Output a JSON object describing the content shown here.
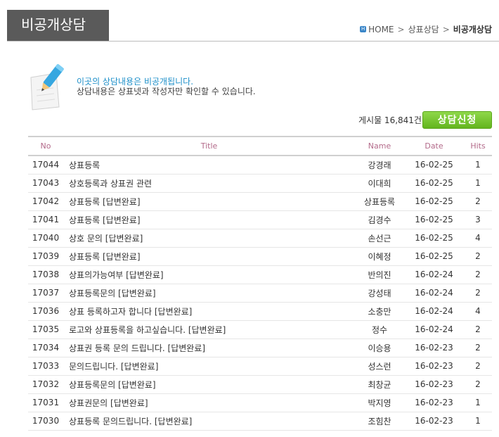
{
  "header": {
    "title": "비공개상담",
    "breadcrumb": {
      "home": "HOME",
      "parent": "상표상담",
      "current": "비공개상담",
      "separator": ">"
    }
  },
  "notice": {
    "line1": "이곳의 상담내용은 비공개됩니다.",
    "line2": "상담내용은 상표넷과 작성자만 확인할 수 있습니다."
  },
  "board": {
    "count_text": "게시물 16,841건",
    "apply_button": "상담신청",
    "columns": {
      "no": "No",
      "title": "Title",
      "name": "Name",
      "date": "Date",
      "hits": "Hits"
    },
    "rows": [
      {
        "no": "17044",
        "title": "상표등록",
        "name": "강경래",
        "date": "16-02-25",
        "hits": "1"
      },
      {
        "no": "17043",
        "title": "상호등록과 상표권 관련",
        "name": "이대희",
        "date": "16-02-25",
        "hits": "1"
      },
      {
        "no": "17042",
        "title": "상표등록 [답변완료]",
        "name": "상표등록",
        "date": "16-02-25",
        "hits": "2"
      },
      {
        "no": "17041",
        "title": "상표등록 [답변완료]",
        "name": "김경수",
        "date": "16-02-25",
        "hits": "3"
      },
      {
        "no": "17040",
        "title": "상호 문의 [답변완료]",
        "name": "손선근",
        "date": "16-02-25",
        "hits": "4"
      },
      {
        "no": "17039",
        "title": "상표등록 [답변완료]",
        "name": "이혜정",
        "date": "16-02-25",
        "hits": "2"
      },
      {
        "no": "17038",
        "title": "상표의가능여부 [답변완료]",
        "name": "반의진",
        "date": "16-02-24",
        "hits": "2"
      },
      {
        "no": "17037",
        "title": "상표등록문의 [답변완료]",
        "name": "강성태",
        "date": "16-02-24",
        "hits": "2"
      },
      {
        "no": "17036",
        "title": "상표 등록하고자 합니다 [답변완료]",
        "name": "소충만",
        "date": "16-02-24",
        "hits": "4"
      },
      {
        "no": "17035",
        "title": "로고와 상표등록을 하고싶습니다. [답변완료]",
        "name": "정수",
        "date": "16-02-24",
        "hits": "2"
      },
      {
        "no": "17034",
        "title": "상표권 등록 문의 드립니다. [답변완료]",
        "name": "이승용",
        "date": "16-02-23",
        "hits": "2"
      },
      {
        "no": "17033",
        "title": "문의드립니다. [답변완료]",
        "name": "성스런",
        "date": "16-02-23",
        "hits": "2"
      },
      {
        "no": "17032",
        "title": "상표등록문의 [답변완료]",
        "name": "최창균",
        "date": "16-02-23",
        "hits": "2"
      },
      {
        "no": "17031",
        "title": "상표권문의 [답변완료]",
        "name": "박지영",
        "date": "16-02-23",
        "hits": "1"
      },
      {
        "no": "17030",
        "title": "상표등록 문의드립니다. [답변완료]",
        "name": "조힘찬",
        "date": "16-02-23",
        "hits": "1"
      }
    ]
  }
}
